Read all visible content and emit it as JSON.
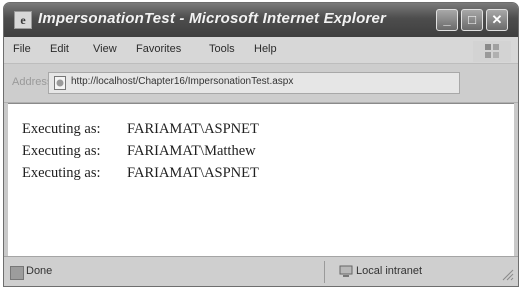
{
  "window": {
    "title": "ImpersonationTest - Microsoft Internet Explorer",
    "app_icon": "ie-page-icon",
    "controls": [
      {
        "name": "minimize-button",
        "glyph": "_"
      },
      {
        "name": "maximize-button",
        "glyph": "□"
      },
      {
        "name": "close-button",
        "glyph": "✕"
      }
    ]
  },
  "menu": {
    "items": [
      "File",
      "Edit",
      "View",
      "Favorites",
      "Tools",
      "Help"
    ]
  },
  "address": {
    "label": "Address",
    "url": "http://localhost/Chapter16/ImpersonationTest.aspx"
  },
  "content": {
    "lines": [
      {
        "label": "Executing as:",
        "value": "FARIAMAT\\ASPNET"
      },
      {
        "label": "Executing as:",
        "value": "FARIAMAT\\Matthew"
      },
      {
        "label": "Executing as:",
        "value": "FARIAMAT\\ASPNET"
      }
    ]
  },
  "status": {
    "text": "Done",
    "zone": "Local intranet"
  },
  "colors": {
    "titlebar": "#4d4d4d",
    "chrome": "#cfcfcf",
    "content_bg": "#ffffff"
  }
}
